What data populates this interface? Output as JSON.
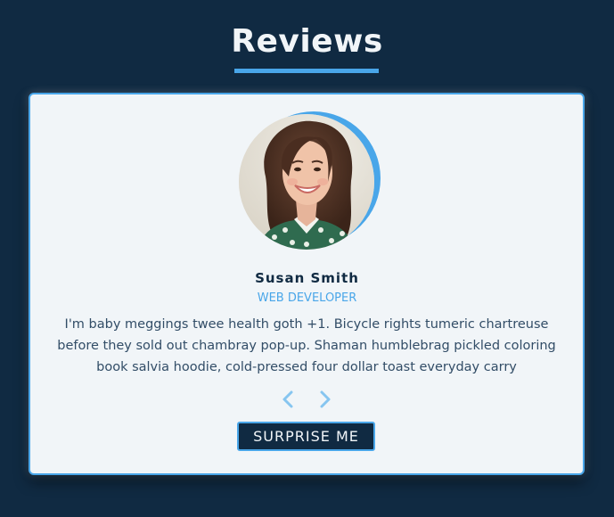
{
  "header": {
    "title": "Reviews"
  },
  "review": {
    "author": "Susan Smith",
    "job": "WEB DEVELOPER",
    "text": "I'm baby meggings twee health goth +1. Bicycle rights tumeric chartreuse before they sold out chambray pop-up. Shaman humblebrag pickled coloring book salvia hoodie, cold-pressed four dollar toast everyday carry"
  },
  "controls": {
    "prev_icon": "chevron-left-icon",
    "next_icon": "chevron-right-icon",
    "random_label": "SURPRISE ME"
  },
  "colors": {
    "background": "#102a42",
    "accent": "#49a6e9",
    "card": "#f1f5f8",
    "text": "#324d67"
  }
}
